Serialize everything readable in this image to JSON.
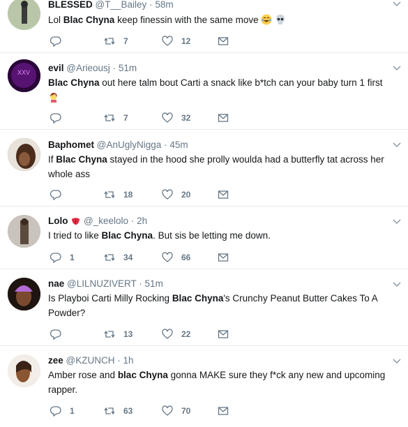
{
  "colors": {
    "text": "#14171a",
    "muted": "#657786",
    "border": "#e6ecf0"
  },
  "tweets": [
    {
      "name": "BLESSED",
      "handle": "@T__Bailey",
      "sep": "·",
      "time": "58m",
      "body": [
        {
          "t": "Lol "
        },
        {
          "t": "Blac Chyna",
          "b": true
        },
        {
          "t": " keep finessin with the same move "
        }
      ],
      "emoji": [
        "face-with-tears-of-joy",
        "skull"
      ],
      "replies": "",
      "retweets": "7",
      "likes": "12"
    },
    {
      "name": "evil",
      "handle": "@Arieousj",
      "sep": "·",
      "time": "51m",
      "body": [
        {
          "t": "Blac Chyna",
          "b": true
        },
        {
          "t": " out here talm bout Carti a snack like b*tch can your baby turn 1 first"
        }
      ],
      "emoji": [
        "woman-facepalming"
      ],
      "replies": "",
      "retweets": "7",
      "likes": "32"
    },
    {
      "name": "Baphomet",
      "handle": "@AnUglyNigga",
      "sep": "·",
      "time": "45m",
      "body": [
        {
          "t": "If "
        },
        {
          "t": "Blac Chyna",
          "b": true
        },
        {
          "t": " stayed in the hood she prolly woulda had a butterfly tat across her whole ass"
        }
      ],
      "emoji": [],
      "replies": "",
      "retweets": "18",
      "likes": "20"
    },
    {
      "name": "Lolo",
      "handle": "@_keelolo",
      "sep": "·",
      "time": "2h",
      "name_emoji": "tongue",
      "body": [
        {
          "t": "I tried to like "
        },
        {
          "t": "Blac Chyna",
          "b": true
        },
        {
          "t": ". But sis be letting me down."
        }
      ],
      "emoji": [],
      "replies": "1",
      "retweets": "34",
      "likes": "66"
    },
    {
      "name": "nae",
      "handle": "@LILNUZIVERT",
      "sep": "·",
      "time": "51m",
      "body": [
        {
          "t": "Is Playboi Carti Milly Rocking "
        },
        {
          "t": "Blac Chyna",
          "b": true
        },
        {
          "t": "'s Crunchy Peanut Butter Cakes To A Powder?"
        }
      ],
      "emoji": [],
      "replies": "",
      "retweets": "13",
      "likes": "22"
    },
    {
      "name": "zee",
      "handle": "@KZUNCH",
      "sep": "·",
      "time": "1h",
      "body": [
        {
          "t": "Amber rose and "
        },
        {
          "t": "blac Chyna",
          "b": true
        },
        {
          "t": " gonna MAKE sure they f*ck any new and upcoming rapper."
        }
      ],
      "emoji": [],
      "replies": "1",
      "retweets": "63",
      "likes": "70"
    }
  ]
}
